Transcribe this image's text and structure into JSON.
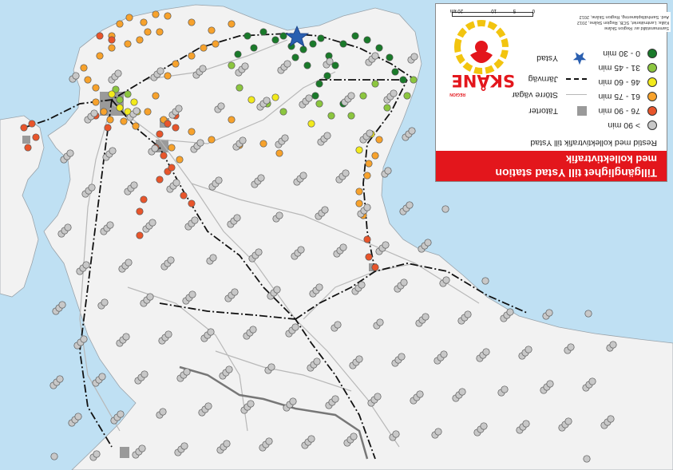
{
  "legend": {
    "title_line1": "Tillgänglighet till Ystad station",
    "title_line2": "med kollektivtrafik",
    "subtitle": "Restid med kollektivtrafik till Ystad",
    "categories": [
      {
        "label": "0 - 30 min",
        "color": "#1a7a2a"
      },
      {
        "label": "31 - 45 min",
        "color": "#8cc63f"
      },
      {
        "label": "46 - 60 min",
        "color": "#f2ea1c"
      },
      {
        "label": "61 - 75 min",
        "color": "#f7a22c"
      },
      {
        "label": "76 - 90 min",
        "color": "#e8552b"
      },
      {
        "label": "> 90 min",
        "color": "#c8c8c8"
      }
    ],
    "symbols": {
      "station": "Ystad",
      "railway": "Järnväg",
      "roads": "Större vägar",
      "urban": "Tätorter"
    },
    "logo_text": "SKÅNE",
    "logo_subtext": "REGION",
    "credits": [
      "Sammanställd av: Region Skåne",
      "Källa: Lantmäteriet, SCB, Region Skåne, 2012",
      "Avd. Samhällsplanering, Region Skåne, 2012"
    ],
    "scale_labels": [
      "0",
      "5",
      "10",
      "20 km"
    ]
  },
  "colors": {
    "sea": "#bfe0f3",
    "land": "#f2f2f2",
    "rail": "#111111",
    "road": "#b8b8b8",
    "star": "#2a5fb0"
  }
}
